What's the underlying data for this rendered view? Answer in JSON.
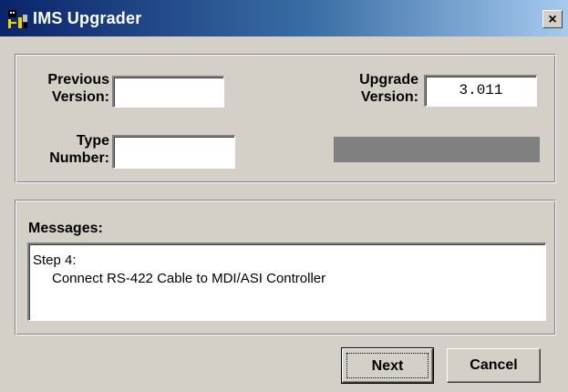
{
  "window": {
    "title": "IMS Upgrader",
    "app_icon": "ims-app-icon",
    "close_label": "×"
  },
  "version_group": {
    "previous_version_label_1": "Previous",
    "previous_version_label_2": "Version:",
    "previous_version_value": "",
    "upgrade_version_label_1": "Upgrade",
    "upgrade_version_label_2": "Version:",
    "upgrade_version_value": "3.011",
    "type_number_label_1": "Type",
    "type_number_label_2": "Number:",
    "type_number_value": "",
    "progress_fraction": 0
  },
  "messages": {
    "label": "Messages:",
    "lines": [
      "Step 4:",
      "Connect RS-422 Cable to MDI/ASI Controller"
    ]
  },
  "buttons": {
    "next": "Next",
    "cancel": "Cancel"
  },
  "colors": {
    "title_bar_start": "#0a246a",
    "title_bar_end": "#a6caf0",
    "face": "#d4d0c8",
    "progress_track": "#808080"
  }
}
